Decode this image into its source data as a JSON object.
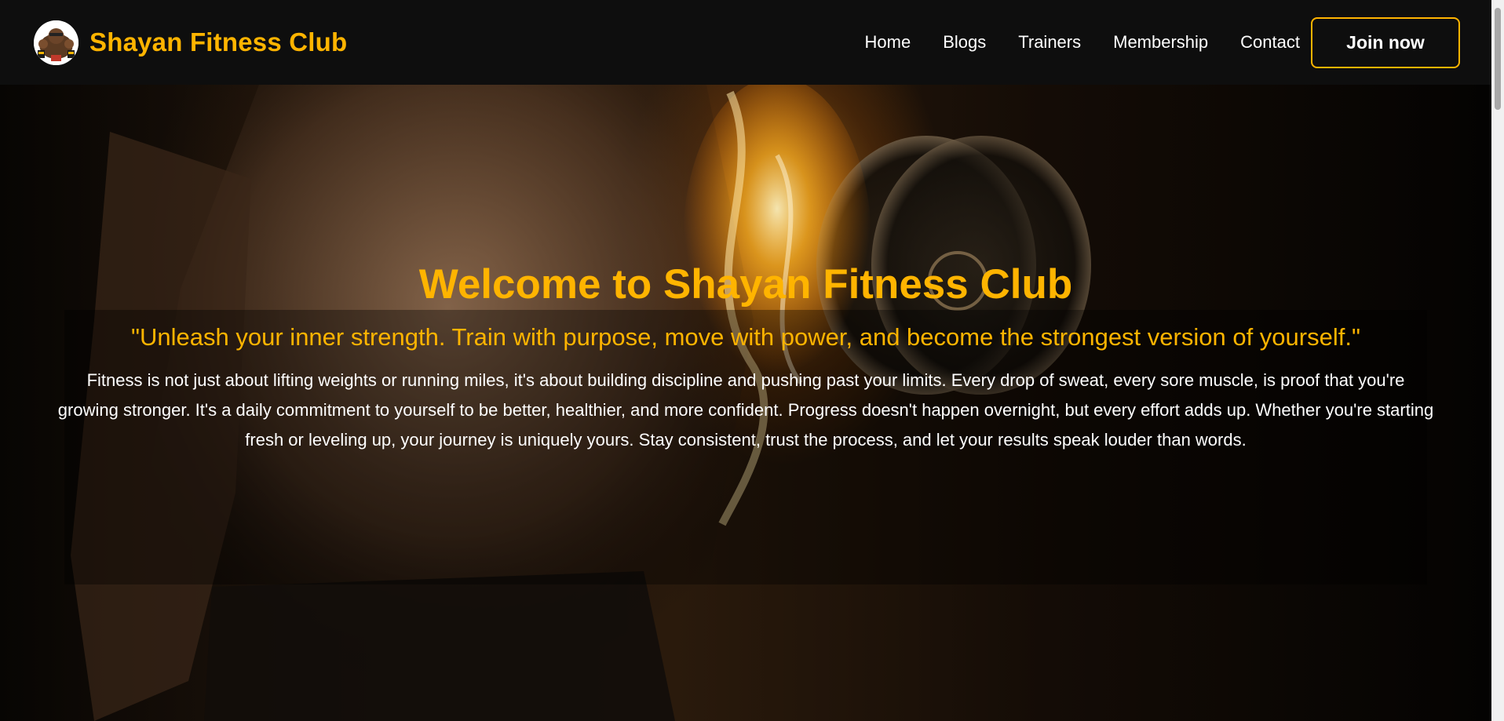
{
  "brand": {
    "name": "Shayan Fitness Club",
    "logo_icon": "bodybuilder-logo-icon"
  },
  "nav": {
    "links": [
      "Home",
      "Blogs",
      "Trainers",
      "Membership",
      "Contact"
    ],
    "cta_label": "Join now"
  },
  "hero": {
    "title": "Welcome to Shayan Fitness Club",
    "quote": "\"Unleash your inner strength. Train with purpose, move with power, and become the strongest version of yourself.\"",
    "body": "Fitness is not just about lifting weights or running miles, it's about building discipline and pushing past your limits. Every drop of sweat, every sore muscle, is proof that you're growing stronger. It's a daily commitment to yourself to be better, healthier, and more confident. Progress doesn't happen overnight, but every effort adds up. Whether you're starting fresh or leveling up, your journey is uniquely yours. Stay consistent, trust the process, and let your results speak louder than words.",
    "background_icon": "athlete-with-flaming-dumbbell-image"
  },
  "colors": {
    "accent": "#ffb400",
    "navbar": "#0e0e0e",
    "text": "#ffffff"
  }
}
